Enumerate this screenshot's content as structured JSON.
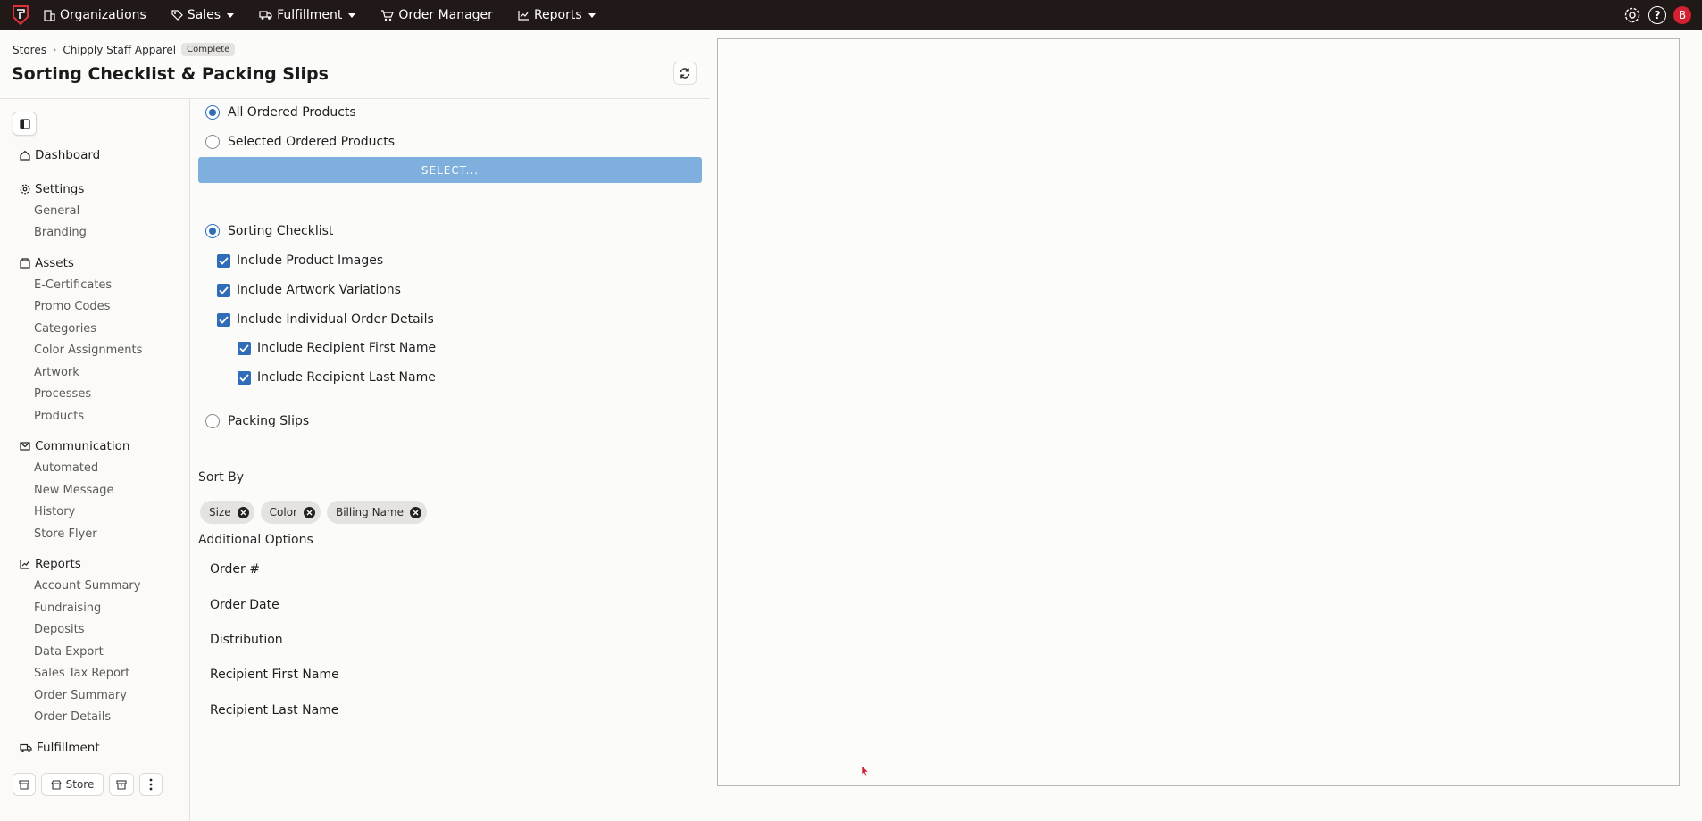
{
  "topbar": {
    "logo_icon": "shield-logo-icon",
    "nav": [
      {
        "label": "Organizations",
        "icon": "building-icon",
        "dropdown": false
      },
      {
        "label": "Sales",
        "icon": "tag-icon",
        "dropdown": true
      },
      {
        "label": "Fulfillment",
        "icon": "truck-icon",
        "dropdown": true
      },
      {
        "label": "Order Manager",
        "icon": "cart-icon",
        "dropdown": false
      },
      {
        "label": "Reports",
        "icon": "chart-icon",
        "dropdown": true
      }
    ],
    "help_label": "?",
    "avatar_initial": "B",
    "avatar_color": "#d42030"
  },
  "header": {
    "breadcrumb": [
      "Stores",
      "Chipply Staff Apparel"
    ],
    "status_badge": "Complete",
    "title": "Sorting Checklist & Packing Slips"
  },
  "sidebar": {
    "sections": [
      {
        "label": "Dashboard",
        "icon": "home-icon",
        "items": []
      },
      {
        "label": "Settings",
        "icon": "gear-icon",
        "items": [
          "General",
          "Branding"
        ]
      },
      {
        "label": "Assets",
        "icon": "assets-icon",
        "items": [
          "E-Certificates",
          "Promo Codes",
          "Categories",
          "Color Assignments",
          "Artwork",
          "Processes",
          "Products"
        ]
      },
      {
        "label": "Communication",
        "icon": "mail-icon",
        "items": [
          "Automated",
          "New Message",
          "History",
          "Store Flyer"
        ]
      },
      {
        "label": "Reports",
        "icon": "chart-icon",
        "items": [
          "Account Summary",
          "Fundraising",
          "Deposits",
          "Data Export",
          "Sales Tax Report",
          "Order Summary",
          "Order Details"
        ]
      },
      {
        "label": "Fulfillment",
        "icon": "truck-icon",
        "items": []
      }
    ],
    "bottom": {
      "store_label": "Store"
    }
  },
  "form": {
    "product_scope": {
      "options": [
        "All Ordered Products",
        "Selected Ordered Products"
      ],
      "selected": "All Ordered Products",
      "select_button": "SELECT..."
    },
    "report_type": {
      "sorting_label": "Sorting Checklist",
      "packing_label": "Packing Slips",
      "selected": "Sorting Checklist"
    },
    "sorting_options": [
      {
        "label": "Include Product Images",
        "checked": true
      },
      {
        "label": "Include Artwork Variations",
        "checked": true
      },
      {
        "label": "Include Individual Order Details",
        "checked": true
      },
      {
        "label": "Include Recipient First Name",
        "checked": true
      },
      {
        "label": "Include Recipient Last Name",
        "checked": true
      }
    ],
    "sort_by_label": "Sort By",
    "sort_chips": [
      "Size",
      "Color",
      "Billing Name"
    ],
    "additional_options_label": "Additional Options",
    "additional_options": [
      "Order #",
      "Order Date",
      "Distribution",
      "Recipient First Name",
      "Recipient Last Name"
    ]
  },
  "colors": {
    "topbar_bg": "#211917",
    "accent": "#2f6db8",
    "select_button_bg": "#7fb0dd"
  }
}
